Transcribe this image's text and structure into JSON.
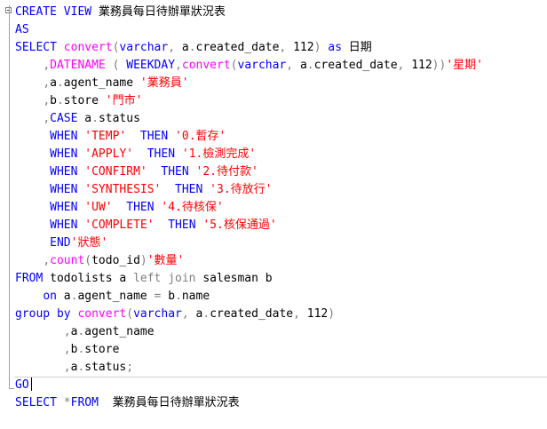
{
  "editor": {
    "lines": [
      [
        {
          "t": "kw",
          "v": "CREATE VIEW "
        },
        {
          "t": "id",
          "v": "業務員每日待辦單狀況表"
        }
      ],
      [
        {
          "t": "kw",
          "v": "AS"
        }
      ],
      [
        {
          "t": "kw",
          "v": "SELECT "
        },
        {
          "t": "fn",
          "v": "convert"
        },
        {
          "t": "op",
          "v": "("
        },
        {
          "t": "kw",
          "v": "varchar"
        },
        {
          "t": "op",
          "v": ", "
        },
        {
          "t": "id",
          "v": "a"
        },
        {
          "t": "op",
          "v": "."
        },
        {
          "t": "id",
          "v": "created_date"
        },
        {
          "t": "op",
          "v": ", "
        },
        {
          "t": "id",
          "v": "112"
        },
        {
          "t": "op",
          "v": ") "
        },
        {
          "t": "kw",
          "v": "as "
        },
        {
          "t": "id",
          "v": "日期"
        }
      ],
      [
        {
          "t": "id",
          "v": "    "
        },
        {
          "t": "op",
          "v": ","
        },
        {
          "t": "fn",
          "v": "DATENAME"
        },
        {
          "t": "id",
          "v": " "
        },
        {
          "t": "op",
          "v": "( "
        },
        {
          "t": "kw",
          "v": "WEEKDAY"
        },
        {
          "t": "op",
          "v": ","
        },
        {
          "t": "fn",
          "v": "convert"
        },
        {
          "t": "op",
          "v": "("
        },
        {
          "t": "kw",
          "v": "varchar"
        },
        {
          "t": "op",
          "v": ", "
        },
        {
          "t": "id",
          "v": "a"
        },
        {
          "t": "op",
          "v": "."
        },
        {
          "t": "id",
          "v": "created_date"
        },
        {
          "t": "op",
          "v": ", "
        },
        {
          "t": "id",
          "v": "112"
        },
        {
          "t": "op",
          "v": "))"
        },
        {
          "t": "str",
          "v": "'星期'"
        }
      ],
      [
        {
          "t": "id",
          "v": "    "
        },
        {
          "t": "op",
          "v": ","
        },
        {
          "t": "id",
          "v": "a"
        },
        {
          "t": "op",
          "v": "."
        },
        {
          "t": "id",
          "v": "agent_name "
        },
        {
          "t": "str",
          "v": "'業務員'"
        }
      ],
      [
        {
          "t": "id",
          "v": "    "
        },
        {
          "t": "op",
          "v": ","
        },
        {
          "t": "id",
          "v": "b"
        },
        {
          "t": "op",
          "v": "."
        },
        {
          "t": "id",
          "v": "store "
        },
        {
          "t": "str",
          "v": "'門市'"
        }
      ],
      [
        {
          "t": "id",
          "v": "    "
        },
        {
          "t": "op",
          "v": ","
        },
        {
          "t": "kw",
          "v": "CASE "
        },
        {
          "t": "id",
          "v": "a"
        },
        {
          "t": "op",
          "v": "."
        },
        {
          "t": "id",
          "v": "status"
        }
      ],
      [
        {
          "t": "id",
          "v": "     "
        },
        {
          "t": "kw",
          "v": "WHEN "
        },
        {
          "t": "str",
          "v": "'TEMP'"
        },
        {
          "t": "id",
          "v": "  "
        },
        {
          "t": "kw",
          "v": "THEN "
        },
        {
          "t": "str",
          "v": "'0.暫存'"
        }
      ],
      [
        {
          "t": "id",
          "v": "     "
        },
        {
          "t": "kw",
          "v": "WHEN "
        },
        {
          "t": "str",
          "v": "'APPLY'"
        },
        {
          "t": "id",
          "v": "  "
        },
        {
          "t": "kw",
          "v": "THEN "
        },
        {
          "t": "str",
          "v": "'1.檢測完成'"
        }
      ],
      [
        {
          "t": "id",
          "v": "     "
        },
        {
          "t": "kw",
          "v": "WHEN "
        },
        {
          "t": "str",
          "v": "'CONFIRM'"
        },
        {
          "t": "id",
          "v": "  "
        },
        {
          "t": "kw",
          "v": "THEN "
        },
        {
          "t": "str",
          "v": "'2.待付款'"
        }
      ],
      [
        {
          "t": "id",
          "v": "     "
        },
        {
          "t": "kw",
          "v": "WHEN "
        },
        {
          "t": "str",
          "v": "'SYNTHESIS'"
        },
        {
          "t": "id",
          "v": "  "
        },
        {
          "t": "kw",
          "v": "THEN "
        },
        {
          "t": "str",
          "v": "'3.待放行'"
        }
      ],
      [
        {
          "t": "id",
          "v": "     "
        },
        {
          "t": "kw",
          "v": "WHEN "
        },
        {
          "t": "str",
          "v": "'UW'"
        },
        {
          "t": "id",
          "v": "  "
        },
        {
          "t": "kw",
          "v": "THEN "
        },
        {
          "t": "str",
          "v": "'4.待核保'"
        }
      ],
      [
        {
          "t": "id",
          "v": "     "
        },
        {
          "t": "kw",
          "v": "WHEN "
        },
        {
          "t": "str",
          "v": "'COMPLETE'"
        },
        {
          "t": "id",
          "v": "  "
        },
        {
          "t": "kw",
          "v": "THEN "
        },
        {
          "t": "str",
          "v": "'5.核保通過'"
        }
      ],
      [
        {
          "t": "id",
          "v": "     "
        },
        {
          "t": "kw",
          "v": "END"
        },
        {
          "t": "str",
          "v": "'狀態'"
        }
      ],
      [
        {
          "t": "id",
          "v": "    "
        },
        {
          "t": "op",
          "v": ","
        },
        {
          "t": "fn",
          "v": "count"
        },
        {
          "t": "op",
          "v": "("
        },
        {
          "t": "id",
          "v": "todo_id"
        },
        {
          "t": "op",
          "v": ")"
        },
        {
          "t": "str",
          "v": "'數量'"
        }
      ],
      [
        {
          "t": "kw",
          "v": "FROM "
        },
        {
          "t": "id",
          "v": "todolists a "
        },
        {
          "t": "op",
          "v": "left join "
        },
        {
          "t": "id",
          "v": "salesman b"
        }
      ],
      [
        {
          "t": "id",
          "v": "    "
        },
        {
          "t": "kw",
          "v": "on "
        },
        {
          "t": "id",
          "v": "a"
        },
        {
          "t": "op",
          "v": "."
        },
        {
          "t": "id",
          "v": "agent_name "
        },
        {
          "t": "op",
          "v": "= "
        },
        {
          "t": "id",
          "v": "b"
        },
        {
          "t": "op",
          "v": "."
        },
        {
          "t": "id",
          "v": "name"
        }
      ],
      [
        {
          "t": "kw",
          "v": "group by "
        },
        {
          "t": "fn",
          "v": "convert"
        },
        {
          "t": "op",
          "v": "("
        },
        {
          "t": "kw",
          "v": "varchar"
        },
        {
          "t": "op",
          "v": ", "
        },
        {
          "t": "id",
          "v": "a"
        },
        {
          "t": "op",
          "v": "."
        },
        {
          "t": "id",
          "v": "created_date"
        },
        {
          "t": "op",
          "v": ", "
        },
        {
          "t": "id",
          "v": "112"
        },
        {
          "t": "op",
          "v": ")"
        }
      ],
      [
        {
          "t": "id",
          "v": "       "
        },
        {
          "t": "op",
          "v": ","
        },
        {
          "t": "id",
          "v": "a"
        },
        {
          "t": "op",
          "v": "."
        },
        {
          "t": "id",
          "v": "agent_name"
        }
      ],
      [
        {
          "t": "id",
          "v": "       "
        },
        {
          "t": "op",
          "v": ","
        },
        {
          "t": "id",
          "v": "b"
        },
        {
          "t": "op",
          "v": "."
        },
        {
          "t": "id",
          "v": "store"
        }
      ],
      [
        {
          "t": "id",
          "v": "       "
        },
        {
          "t": "op",
          "v": ","
        },
        {
          "t": "id",
          "v": "a"
        },
        {
          "t": "op",
          "v": "."
        },
        {
          "t": "id",
          "v": "status"
        },
        {
          "t": "op",
          "v": ";"
        }
      ],
      [
        {
          "t": "kw",
          "v": "GO"
        }
      ],
      [
        {
          "t": "kw",
          "v": "SELECT "
        },
        {
          "t": "op",
          "v": "*"
        },
        {
          "t": "kw",
          "v": "FROM  "
        },
        {
          "t": "id",
          "v": "業務員每日待辦單狀況表"
        }
      ]
    ],
    "caret_line": 21
  }
}
